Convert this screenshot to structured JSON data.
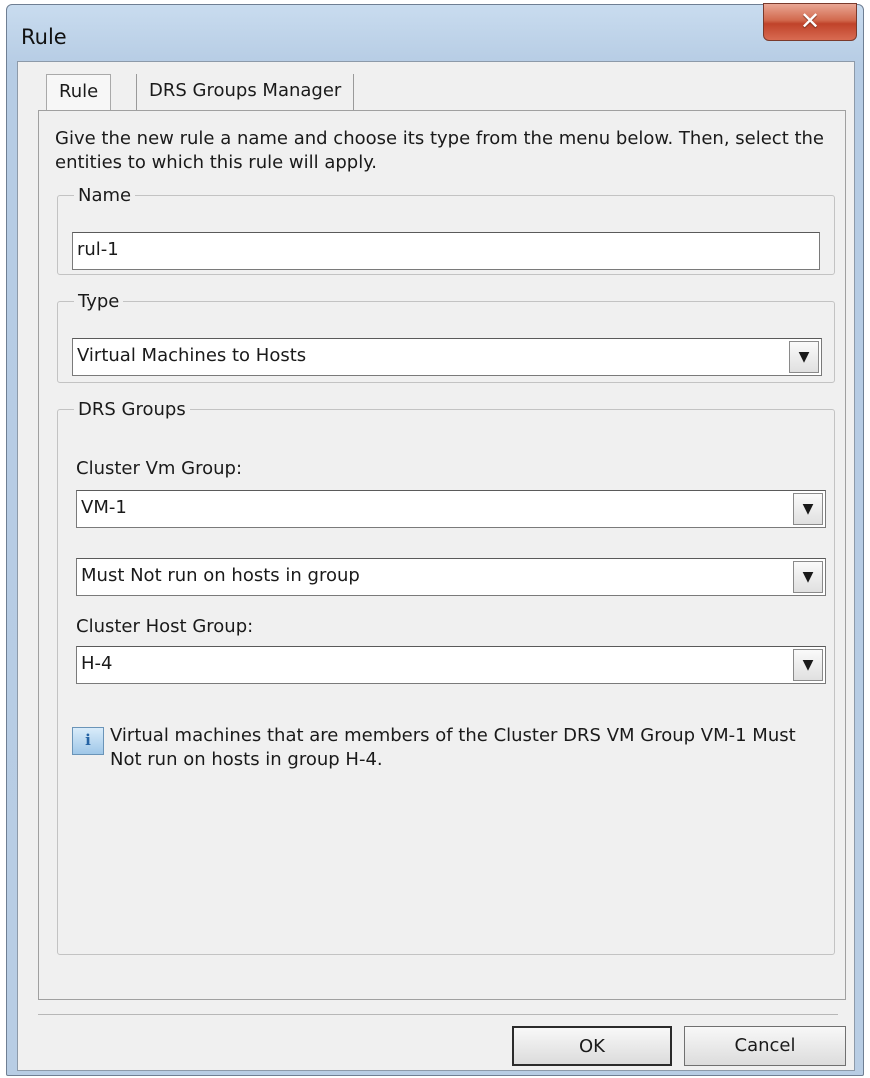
{
  "window": {
    "title": "Rule",
    "close_glyph": "✕"
  },
  "tabs": [
    {
      "label": "Rule"
    },
    {
      "label": "DRS Groups Manager"
    }
  ],
  "instructions": "Give the new rule a name and choose its type from the menu below. Then, select the entities to which this rule will apply.",
  "name_group": {
    "legend": "Name",
    "value": "rul-1"
  },
  "type_group": {
    "legend": "Type",
    "value": "Virtual Machines to Hosts"
  },
  "drs_group": {
    "legend": "DRS Groups",
    "vm_group_label": "Cluster Vm Group:",
    "vm_group_value": "VM-1",
    "relation_value": "Must Not run on hosts in group",
    "host_group_label": "Cluster Host Group:",
    "host_group_value": "H-4",
    "info_text": "Virtual machines that are members of the Cluster DRS VM Group VM-1 Must Not run on hosts in group H-4."
  },
  "buttons": {
    "ok": "OK",
    "cancel": "Cancel"
  },
  "icons": {
    "info": "info-icon",
    "dropdown": "▼"
  }
}
